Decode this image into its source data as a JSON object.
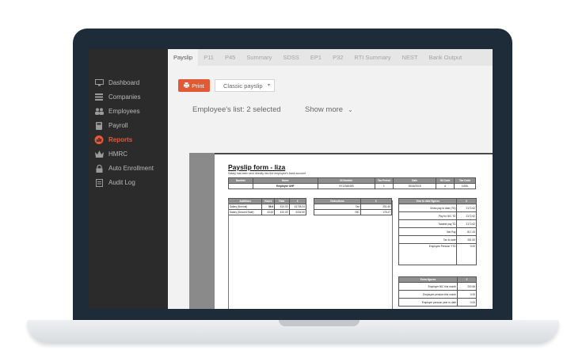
{
  "sidebar": {
    "items": [
      {
        "label": "Dashboard",
        "icon": "monitor-icon",
        "active": false
      },
      {
        "label": "Companies",
        "icon": "list-icon",
        "active": false
      },
      {
        "label": "Employees",
        "icon": "users-icon",
        "active": false
      },
      {
        "label": "Payroll",
        "icon": "calculator-icon",
        "active": false
      },
      {
        "label": "Reports",
        "icon": "reports-icon",
        "active": true
      },
      {
        "label": "HMRC",
        "icon": "crown-icon",
        "active": false
      },
      {
        "label": "Auto Enrollment",
        "icon": "lock-icon",
        "active": false
      },
      {
        "label": "Audit Log",
        "icon": "audit-icon",
        "active": false
      }
    ]
  },
  "tabs": [
    "Payslip",
    "P11",
    "P45",
    "Summary",
    "SDSS",
    "EP1",
    "P32",
    "RTI Summary",
    "NEST",
    "Bank Output"
  ],
  "active_tab": "Payslip",
  "toolbar": {
    "print_label": "Print",
    "select_value": "Classic payslip",
    "employees_label": "Employee's list: 2 selected",
    "show_more_label": "Show more"
  },
  "payslip": {
    "title": "Payslip form - liza",
    "subtitle": "Salary has been sent directly into the employee's bank account",
    "header_cols": [
      "Number",
      "Name",
      "NI Number",
      "Tax Period",
      "Date",
      "NI Code",
      "Tax Code"
    ],
    "header_row": [
      "",
      "Employee UHF",
      "XX1234546S",
      "1",
      "30/04/2018",
      "A",
      "1150L"
    ],
    "additions_cols": [
      "Additions",
      "Hours",
      "Rate",
      "£"
    ],
    "additions_rows": [
      [
        "Salary (Normal)",
        "36.9",
        "£10.00",
        "£1738.24"
      ],
      [
        "Salary (Second Rate)",
        "43.45",
        "£10.00",
        "£434.50"
      ]
    ],
    "deductions_cols": [
      "Deductions",
      "£"
    ],
    "deductions_rows": [
      [
        "Tax",
        "251.60"
      ],
      [
        "NIC",
        "176.47"
      ]
    ],
    "ytd_cols": [
      "Year to date figures",
      "£"
    ],
    "ytd_rows": [
      [
        "Gross pay to date (TD)",
        "2172.62"
      ],
      [
        "Pay for NIC TD",
        "2172.62"
      ],
      [
        "Taxable pay TD",
        "2172.62"
      ],
      [
        "Net Pay",
        "817.43"
      ],
      [
        "Tax to date",
        "251.60"
      ],
      [
        "Employee Pension YTD",
        "0.00"
      ]
    ],
    "extra_cols": [
      "Extra figures",
      "£"
    ],
    "extra_rows": [
      [
        "Employer NIC this month",
        "202.66"
      ],
      [
        "Employee pension this month",
        "0.00"
      ],
      [
        "Employer pension year to date",
        "0.00"
      ]
    ]
  }
}
